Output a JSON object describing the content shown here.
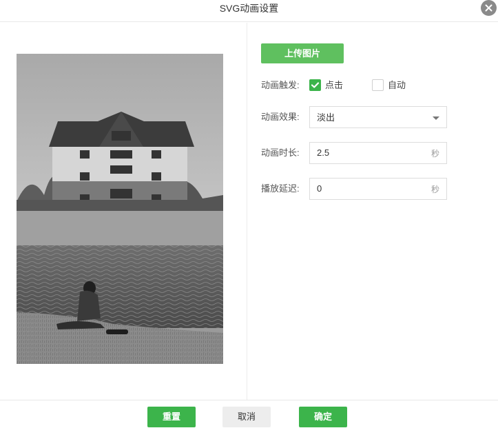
{
  "dialog": {
    "title": "SVG动画设置"
  },
  "upload": {
    "label": "上传图片"
  },
  "trigger": {
    "label": "动画触发:",
    "options": [
      {
        "label": "点击",
        "checked": true
      },
      {
        "label": "自动",
        "checked": false
      }
    ]
  },
  "effect": {
    "label": "动画效果:",
    "selected": "淡出"
  },
  "duration": {
    "label": "动画时长:",
    "value": "2.5",
    "unit": "秒"
  },
  "delay": {
    "label": "播放延迟:",
    "value": "0",
    "unit": "秒"
  },
  "footer": {
    "reset": "重置",
    "cancel": "取消",
    "confirm": "确定"
  },
  "colors": {
    "primary_green": "#3cb44b",
    "upload_green": "#5fc05f",
    "close_gray": "#8a8a8a"
  },
  "icons": {
    "close": "close-icon",
    "dropdown": "chevron-down-icon",
    "check": "checkmark-icon"
  }
}
